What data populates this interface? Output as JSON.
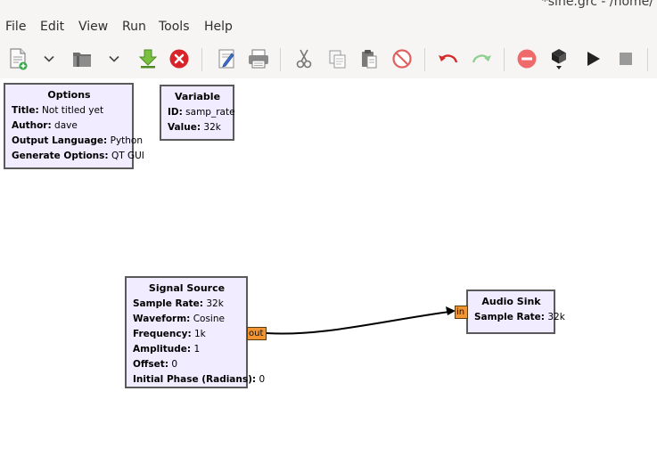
{
  "window": {
    "title": "*sine.grc - /home/"
  },
  "menu": [
    "File",
    "Edit",
    "View",
    "Run",
    "Tools",
    "Help"
  ],
  "toolbar": {
    "icons": [
      "new-document-icon",
      "new-dropdown-chevron-icon",
      "open-folder-icon",
      "open-dropdown-chevron-icon",
      "save-download-icon",
      "close-icon",
      "edit-properties-icon",
      "print-icon",
      "cut-icon",
      "copy-icon",
      "paste-icon",
      "delete-icon",
      "undo-icon",
      "redo-icon",
      "disable-block-icon",
      "bypass-block-icon",
      "run-play-icon",
      "stop-icon"
    ]
  },
  "blocks": {
    "options": {
      "title": "Options",
      "rows": [
        {
          "label": "Title:",
          "value": "Not titled yet"
        },
        {
          "label": "Author:",
          "value": "dave"
        },
        {
          "label": "Output Language:",
          "value": "Python"
        },
        {
          "label": "Generate Options:",
          "value": "QT GUI"
        }
      ]
    },
    "variable": {
      "title": "Variable",
      "rows": [
        {
          "label": "ID:",
          "value": "samp_rate"
        },
        {
          "label": "Value:",
          "value": "32k"
        }
      ]
    },
    "signal_source": {
      "title": "Signal Source",
      "rows": [
        {
          "label": "Sample Rate:",
          "value": "32k"
        },
        {
          "label": "Waveform:",
          "value": "Cosine"
        },
        {
          "label": "Frequency:",
          "value": "1k"
        },
        {
          "label": "Amplitude:",
          "value": "1"
        },
        {
          "label": "Offset:",
          "value": "0"
        },
        {
          "label": "Initial Phase (Radians):",
          "value": "0"
        }
      ],
      "port_out": "out"
    },
    "audio_sink": {
      "title": "Audio Sink",
      "rows": [
        {
          "label": "Sample Rate:",
          "value": "32k"
        }
      ],
      "port_in": "in"
    }
  },
  "colors": {
    "block_fill": "#f1ecff",
    "port_fill": "#f49431",
    "chrome_bg": "#f6f5f4"
  }
}
